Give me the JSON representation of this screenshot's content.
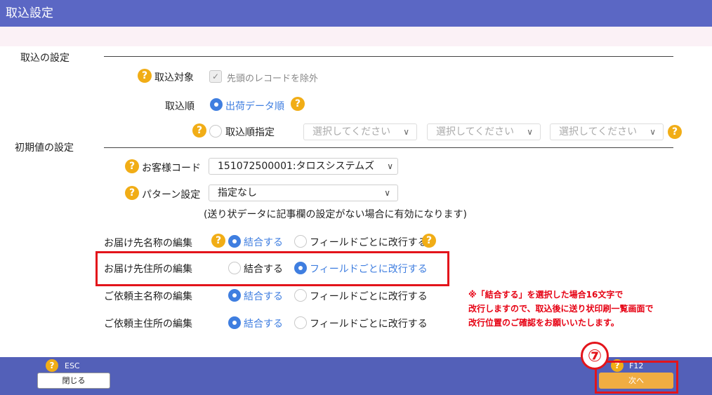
{
  "window": {
    "title": "取込設定"
  },
  "sections": {
    "import": "取込の設定",
    "initial": "初期値の設定"
  },
  "target": {
    "help": "?",
    "label": "取込対象",
    "checkbox_mark": "✓",
    "checkbox_label": "先頭のレコードを除外"
  },
  "order": {
    "label": "取込順",
    "options": [
      "出荷データ順",
      "取込順指定"
    ],
    "selected": "出荷データ順",
    "help": "?",
    "selects": [
      "選択してください",
      "選択してください",
      "選択してください"
    ],
    "chevron": "∨"
  },
  "customer": {
    "label": "お客様コード",
    "value": "151072500001:タロスシステムズ",
    "chevron": "∨"
  },
  "pattern": {
    "label": "パターン設定",
    "value": "指定なし",
    "chevron": "∨",
    "note": "(送り状データに記事欄の設定がない場合に有効になります)"
  },
  "edit_rows": [
    {
      "label": "お届け先名称の編集",
      "opt1": "結合する",
      "opt2": "フィールドごとに改行する",
      "selected": 1
    },
    {
      "label": "お届け先住所の編集",
      "opt1": "結合する",
      "opt2": "フィールドごとに改行する",
      "selected": 2
    },
    {
      "label": "ご依頼主名称の編集",
      "opt1": "結合する",
      "opt2": "フィールドごとに改行する",
      "selected": 1
    },
    {
      "label": "ご依頼主住所の編集",
      "opt1": "結合する",
      "opt2": "フィールドごとに改行する",
      "selected": 1
    }
  ],
  "warning": {
    "line1": "※「結合する」を選択した場合16文字で",
    "line2": "改行しますので、取込後に送り状印刷一覧画面で",
    "line3": "改行位置のご確認をお願いいたします。"
  },
  "footer": {
    "esc_key": "ESC",
    "close_label": "閉じる",
    "f12_key": "F12",
    "next_label": "次へ",
    "step_marker": "⑦"
  },
  "colors": {
    "titlebar": "#5b67c4",
    "accent_blue": "#3f7ee0",
    "help_orange": "#f1ad16",
    "highlight_red": "#e3141b",
    "next_button": "#f0ad42"
  }
}
